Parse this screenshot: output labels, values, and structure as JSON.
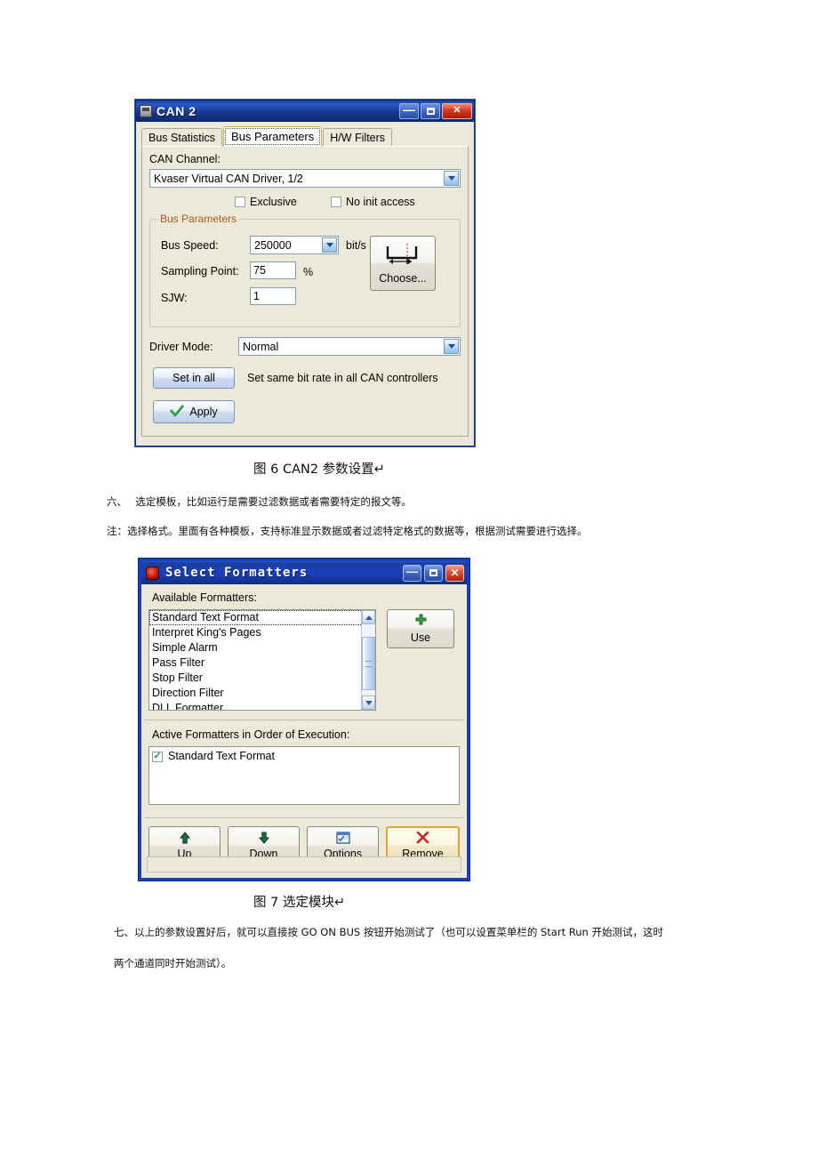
{
  "can_window": {
    "title": "CAN 2",
    "titlebar_buttons": [
      {
        "name": "minimize",
        "glyph": "—"
      },
      {
        "name": "maximize",
        "glyph": ""
      },
      {
        "name": "close",
        "glyph": "✕"
      }
    ],
    "tabs": [
      {
        "label": "Bus Statistics",
        "accel": "S",
        "active": false
      },
      {
        "label": "Bus Parameters",
        "accel": "",
        "active": true
      },
      {
        "label": "H/W Filters",
        "accel": "W",
        "active": false
      }
    ],
    "channel_label": "CAN Channel:",
    "channel_value": "Kvaser Virtual CAN Driver, 1/2",
    "checkboxes": [
      {
        "label": "Exclusive",
        "checked": false
      },
      {
        "label": "No init access",
        "checked": false
      }
    ],
    "group_legend": "Bus Parameters",
    "bus_speed_label": "Bus Speed:",
    "bus_speed_value": "250000",
    "bus_speed_unit": "bit/s",
    "sampling_point_label": "Sampling Point:",
    "sampling_point_value": "75",
    "sampling_point_unit": "%",
    "sjw_label": "SJW:",
    "sjw_value": "1",
    "choose_button": "Choose...",
    "driver_mode_label": "Driver Mode:",
    "driver_mode_value": "Normal",
    "set_in_all_button": "Set in all",
    "set_in_all_hint": "Set same bit rate in all CAN controllers",
    "apply_button": "Apply"
  },
  "caption_fig6": "图 6 CAN2 参数设置↵",
  "para_six": "六、　 选定模板，比如运行是需要过滤数据或者需要特定的报文等。",
  "para_note": "注：选择格式。里面有各种模板，支持标准显示数据或者过滤特定格式的数据等，根据测试需要进行选择。",
  "sf_window": {
    "title": "Select Formatters",
    "titlebar_buttons": [
      {
        "name": "minimize",
        "glyph": "—"
      },
      {
        "name": "maximize",
        "glyph": ""
      },
      {
        "name": "close",
        "glyph": "✕"
      }
    ],
    "available_label": "Available Formatters:",
    "available_items": [
      "Standard Text Format",
      "Interpret King's Pages",
      "Simple Alarm",
      "Pass Filter",
      "Stop Filter",
      "Direction Filter",
      "DLL Formatter"
    ],
    "selected_index": 0,
    "use_button": "Use",
    "active_label": "Active Formatters in Order of Execution:",
    "active_items": [
      {
        "label": "Standard Text Format",
        "checked": true
      }
    ],
    "bottom_buttons": [
      {
        "label": "Up",
        "icon": "arrow-up-icon",
        "highlighted": false
      },
      {
        "label": "Down",
        "icon": "arrow-down-icon",
        "highlighted": false
      },
      {
        "label": "Options",
        "icon": "options-checklist-icon",
        "highlighted": false
      },
      {
        "label": "Remove",
        "icon": "red-x-icon",
        "highlighted": true
      }
    ]
  },
  "caption_fig7": "图 7  选定模块↵",
  "para_seven_line1": "七、以上的参数设置好后，就可以直接按 GO ON BUS 按钮开始测试了（也可以设置菜单栏的 Start Run 开始测试，这时",
  "para_seven_line2": "两个通道同时开始测试）。",
  "colors": {
    "titlebar_blue": "#1a3fbd",
    "close_red": "#d53a22",
    "dialog_face": "#ece9d8",
    "group_legend_orange": "#b05a1e",
    "accent_green": "#2e8b3a",
    "highlight_gold": "#e0a62a"
  }
}
